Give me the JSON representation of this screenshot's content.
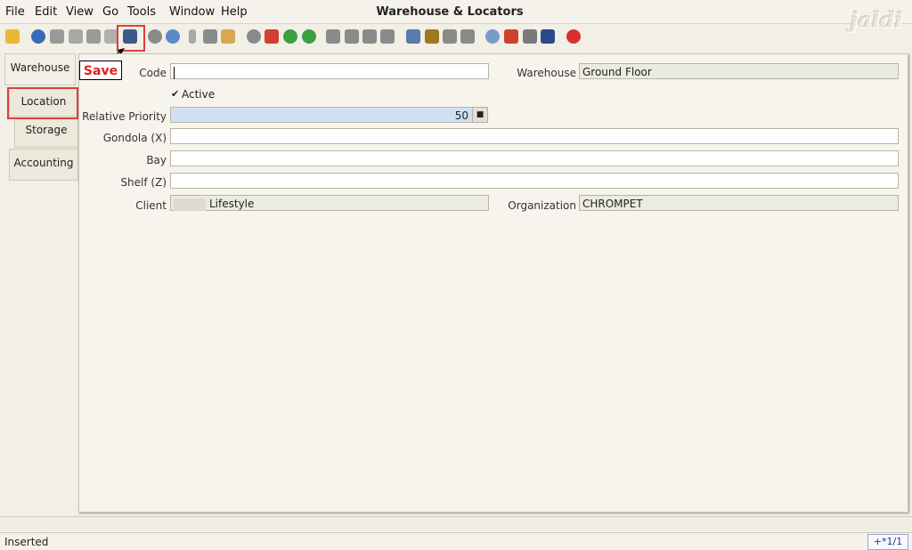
{
  "menu": {
    "file": "File",
    "edit": "Edit",
    "view": "View",
    "go": "Go",
    "tools": "Tools",
    "window": "Window",
    "help": "Help"
  },
  "window_title": "Warehouse & Locators",
  "logo_text": "jaldi",
  "toolbar_icons": [
    "undo-icon",
    "help-icon",
    "new-icon",
    "copy-icon",
    "delete-icon",
    "delete-selection-icon",
    "save-icon",
    "refresh-icon",
    "find-icon",
    "attachment-icon",
    "chat-icon",
    "grid-toggle-icon",
    "history-icon",
    "home-icon",
    "back-icon",
    "forward-icon",
    "first-record-icon",
    "previous-record-icon",
    "next-record-icon",
    "last-record-icon",
    "report-icon",
    "archive-icon",
    "print-preview-icon",
    "print-icon",
    "zoom-across-icon",
    "workflow-icon",
    "request-icon",
    "product-info-icon",
    "exit-icon"
  ],
  "annotation": {
    "save_label": "Save",
    "highlight_color": "#e03c3c"
  },
  "tabs": [
    {
      "label": "Warehouse"
    },
    {
      "label": "Location"
    },
    {
      "label": "Storage"
    },
    {
      "label": "Accounting"
    }
  ],
  "form": {
    "code_label": "Code",
    "code_value": "",
    "warehouse_label": "Warehouse",
    "warehouse_value": "Ground Floor",
    "active_label": "Active",
    "active_checked": true,
    "priority_label": "Relative Priority",
    "priority_value": "50",
    "gondola_label": "Gondola (X)",
    "gondola_value": "",
    "bay_label": "Bay",
    "bay_value": "",
    "shelf_label": "Shelf (Z)",
    "shelf_value": "",
    "client_label": "Client",
    "client_value": "Lifestyle",
    "org_label": "Organization",
    "org_value": "CHROMPET"
  },
  "status": {
    "message": "Inserted",
    "record_nav": "+*1/1"
  }
}
